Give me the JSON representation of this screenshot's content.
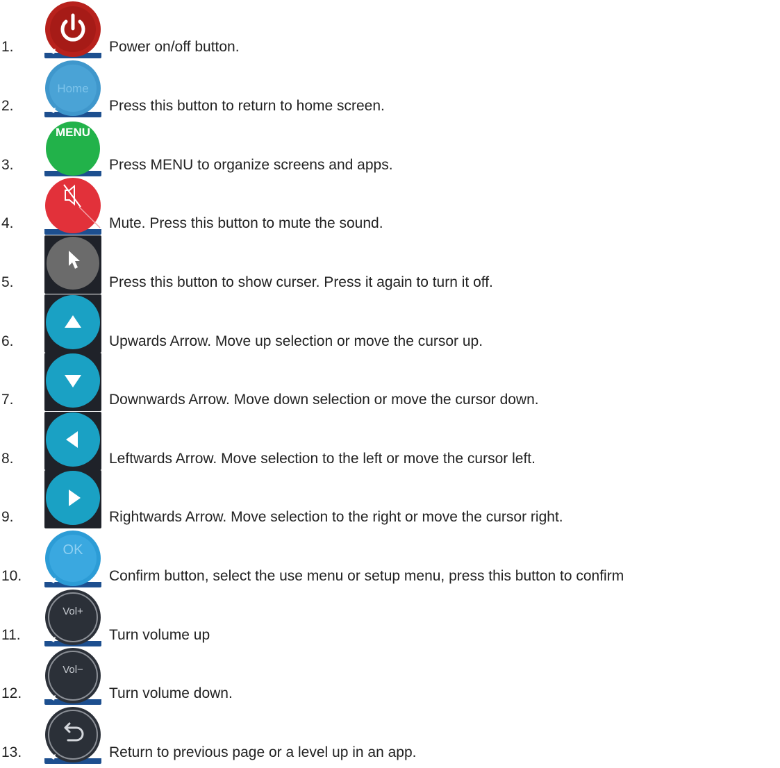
{
  "items": [
    {
      "number": "1.",
      "icon": "power-icon",
      "description": "Power on/off button."
    },
    {
      "number": "2.",
      "icon": "home-icon",
      "label": "Home",
      "description": "Press this button to return to home screen."
    },
    {
      "number": "3.",
      "icon": "menu-icon",
      "label": "MENU",
      "description": "Press MENU to organize screens and apps."
    },
    {
      "number": "4.",
      "icon": "mute-icon",
      "description": "Mute. Press this button to mute the sound."
    },
    {
      "number": "5.",
      "icon": "cursor-icon",
      "description": "Press this button to show curser. Press it again to turn it off."
    },
    {
      "number": "6.",
      "icon": "arrow-up-icon",
      "description": "Upwards Arrow. Move up selection or move the cursor up."
    },
    {
      "number": "7.",
      "icon": "arrow-down-icon",
      "description": "Downwards Arrow. Move down selection or move the cursor down."
    },
    {
      "number": "8.",
      "icon": "arrow-left-icon",
      "description": "Leftwards Arrow. Move selection to the left or move the cursor left."
    },
    {
      "number": "9.",
      "icon": "arrow-right-icon",
      "description": "Rightwards Arrow. Move selection to the right or move the cursor right."
    },
    {
      "number": "10.",
      "icon": "ok-icon",
      "label": "OK",
      "description": "Confirm button, select the use menu or setup menu, press this button to confirm"
    },
    {
      "number": "11.",
      "icon": "volume-up-icon",
      "label": "Vol+",
      "description": "Turn volume up"
    },
    {
      "number": "12.",
      "icon": "volume-down-icon",
      "label": "Vol−",
      "description": "Turn volume down."
    },
    {
      "number": "13.",
      "icon": "return-icon",
      "description": "Return to previous page or a level up in an app."
    }
  ],
  "colors": {
    "power": "#b7211c",
    "home": "#3f97cc",
    "menu": "#22b24a",
    "mute": "#e2313a",
    "cursor": "#6b6b6b",
    "arrow": "#1aa1c4",
    "ok": "#2c9cd6",
    "dark": "#2b3038",
    "tile": "#1f2229"
  }
}
